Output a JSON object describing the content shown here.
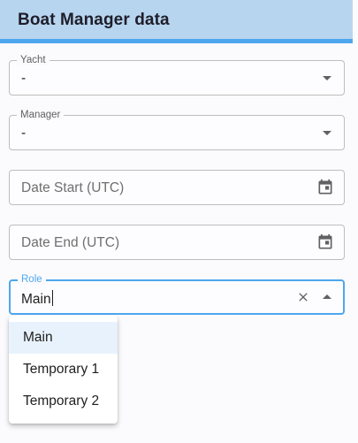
{
  "header": {
    "title": "Boat Manager data"
  },
  "form": {
    "yacht": {
      "label": "Yacht",
      "value": "-"
    },
    "manager": {
      "label": "Manager",
      "value": "-"
    },
    "date_start": {
      "placeholder": "Date Start (UTC)"
    },
    "date_end": {
      "placeholder": "Date End (UTC)"
    },
    "role": {
      "label": "Role",
      "value": "Main"
    }
  },
  "role_options": [
    "Main",
    "Temporary 1",
    "Temporary 2"
  ],
  "colors": {
    "accent": "#4ea6ee",
    "header_bg": "#b8d5f0",
    "selected_option_bg": "#e8f2fc"
  }
}
